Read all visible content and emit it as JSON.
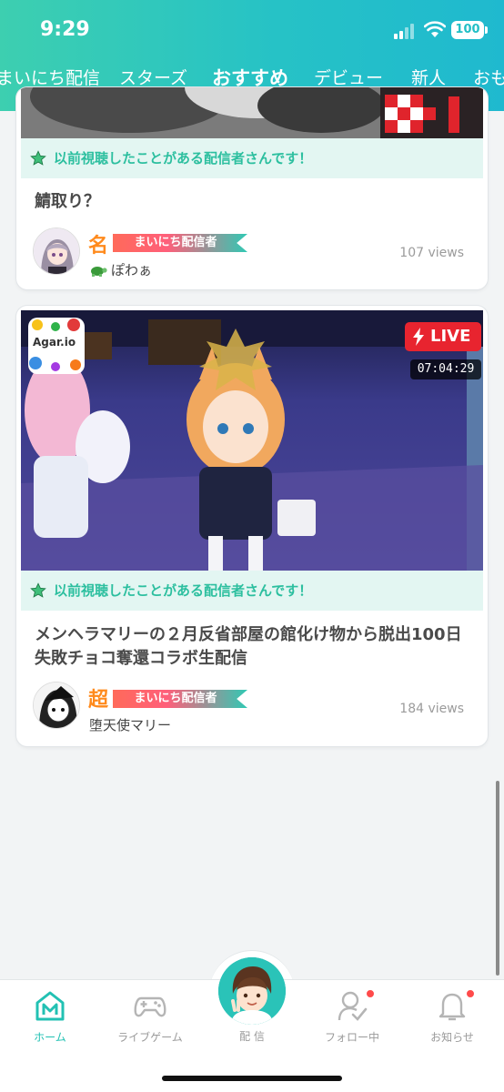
{
  "status_bar": {
    "time": "9:29",
    "battery": "100"
  },
  "tabs": [
    {
      "label": "まいにち配信"
    },
    {
      "label": "スターズ"
    },
    {
      "label": "おすすめ"
    },
    {
      "label": "デビュー"
    },
    {
      "label": "新人"
    },
    {
      "label": "おも"
    }
  ],
  "active_tab": "おすすめ",
  "feed": [
    {
      "history_note": "以前視聴したことがある配信者さんです！",
      "title": "鯖取り？",
      "rank_glyph": "名",
      "badge": "まいにち配信者",
      "streamer": "ぽわぁ",
      "views": "107 views"
    },
    {
      "live_label": "LIVE",
      "duration": "07:04:29",
      "game_name": "Agar.io",
      "history_note": "以前視聴したことがある配信者さんです！",
      "title": "メンヘラマリーの２月反省部屋の館化け物から脱出100日失敗チョコ奪還コラボ生配信",
      "rank_glyph": "超",
      "badge": "まいにち配信者",
      "streamer": "堕天使マリー",
      "views": "184 views"
    }
  ],
  "bottom_nav": {
    "home": "ホーム",
    "live_game": "ライブゲーム",
    "broadcast": "配 信",
    "following": "フォロー中",
    "notifications": "お知らせ"
  },
  "colors": {
    "accent": "#22c1b3",
    "live_red": "#e8242f",
    "notify_dot": "#ff4b4b"
  }
}
